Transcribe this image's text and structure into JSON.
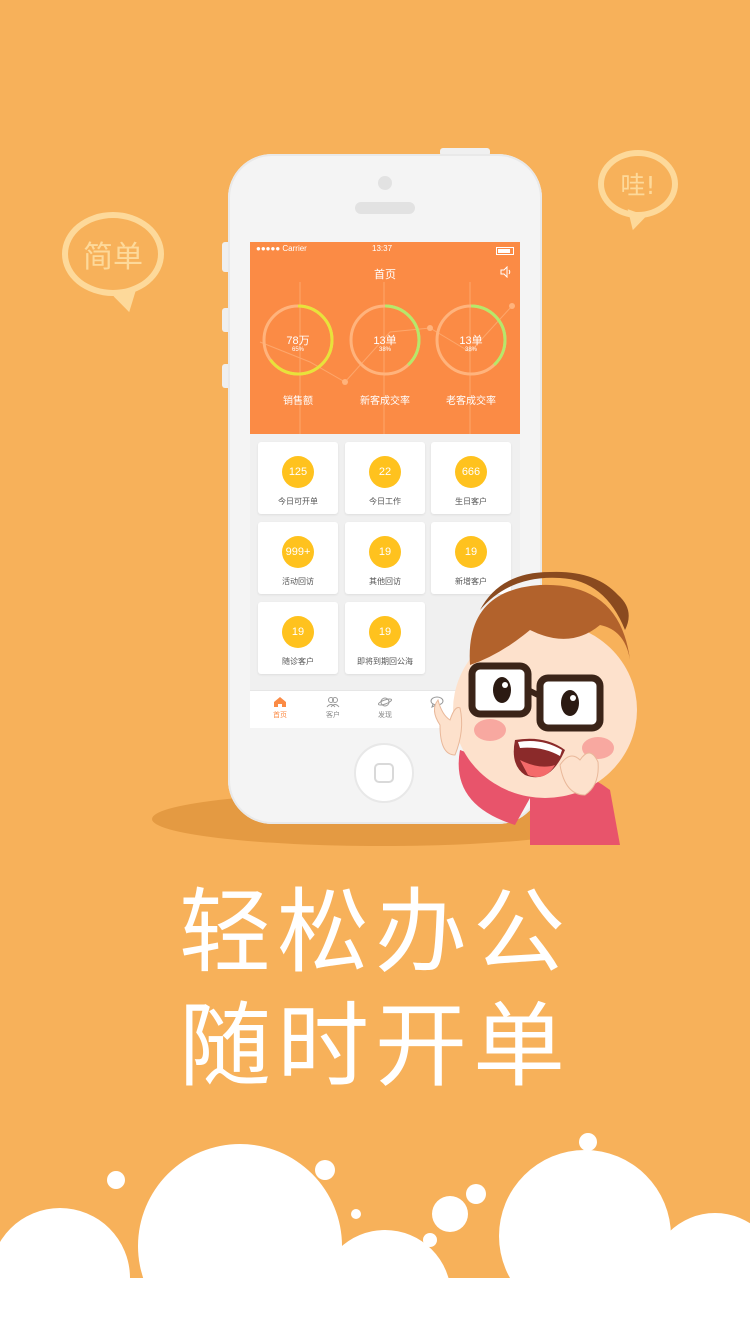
{
  "bubbles": {
    "left": "简单",
    "right": "哇!"
  },
  "phone": {
    "status": {
      "carrier": "●●●●● Carrier",
      "time": "13:37"
    },
    "title": "首页",
    "stats": [
      {
        "value": "78万",
        "percent": "65%",
        "label": "销售额",
        "progress": 0.65,
        "ring_color": "#E8E23A"
      },
      {
        "value": "13单",
        "percent": "38%",
        "label": "新客成交率",
        "progress": 0.38,
        "ring_color": "#B6E86A"
      },
      {
        "value": "13单",
        "percent": "38%",
        "label": "老客成交率",
        "progress": 0.38,
        "ring_color": "#B6E86A"
      }
    ],
    "cards": [
      {
        "count": "125",
        "label": "今日可开单"
      },
      {
        "count": "22",
        "label": "今日工作"
      },
      {
        "count": "666",
        "label": "生日客户"
      },
      {
        "count": "999+",
        "label": "活动回访"
      },
      {
        "count": "19",
        "label": "其他回访"
      },
      {
        "count": "19",
        "label": "新增客户"
      },
      {
        "count": "19",
        "label": "随诊客户"
      },
      {
        "count": "19",
        "label": "即将到期回公海"
      }
    ],
    "tabs": [
      {
        "label": "首页",
        "icon": "home-icon",
        "active": true
      },
      {
        "label": "客户",
        "icon": "customers-icon",
        "active": false
      },
      {
        "label": "发现",
        "icon": "planet-icon",
        "active": false
      },
      {
        "label": "",
        "icon": "chat-icon",
        "active": false
      }
    ]
  },
  "slogan": {
    "line1": "轻松办公",
    "line2": "随时开单"
  },
  "colors": {
    "background": "#F7B15A",
    "header": "#FB8B45",
    "badge": "#FFC21E",
    "bubble": "#FDD99A"
  }
}
